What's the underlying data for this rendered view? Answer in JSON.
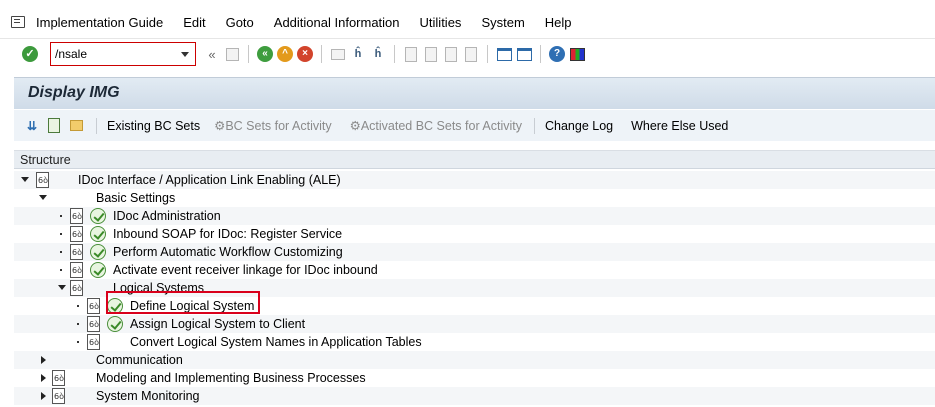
{
  "menubar": {
    "items": [
      "Implementation Guide",
      "Edit",
      "Goto",
      "Additional Information",
      "Utilities",
      "System",
      "Help"
    ]
  },
  "toolbar": {
    "command_value": "/nsale",
    "icons": [
      "enter-icon",
      "back-double-icon",
      "save-icon",
      "back-icon",
      "exit-icon",
      "cancel-icon",
      "print-icon",
      "find-icon",
      "find-next-icon",
      "first-page-icon",
      "previous-page-icon",
      "next-page-icon",
      "last-page-icon",
      "new-session-icon",
      "shortcut-icon",
      "help-icon",
      "layout-icon"
    ]
  },
  "title": "Display IMG",
  "app_toolbar": {
    "existing_bc_sets": "Existing BC Sets",
    "bc_sets_for_activity": "BC Sets for Activity",
    "activated_bc_sets": "Activated BC Sets for Activity",
    "change_log": "Change Log",
    "where_else_used": "Where Else Used"
  },
  "tree": {
    "header": "Structure",
    "rows": [
      {
        "label": "IDoc Interface / Application Link Enabling (ALE)",
        "level": 0,
        "expanded": true
      },
      {
        "label": "Basic Settings",
        "level": 1,
        "expanded": true
      },
      {
        "label": "IDoc Administration",
        "level": 2
      },
      {
        "label": "Inbound SOAP for IDoc: Register Service",
        "level": 2
      },
      {
        "label": "Perform Automatic Workflow Customizing",
        "level": 2
      },
      {
        "label": "Activate event receiver linkage for IDoc inbound",
        "level": 2
      },
      {
        "label": "Logical Systems",
        "level": 2,
        "expanded": true
      },
      {
        "label": "Define Logical System",
        "level": 3,
        "highlighted": true
      },
      {
        "label": "Assign Logical System to Client",
        "level": 3
      },
      {
        "label": "Convert Logical System Names in Application Tables",
        "level": 3
      },
      {
        "label": "Communication",
        "level": 1,
        "expanded": false
      },
      {
        "label": "Modeling and Implementing Business Processes",
        "level": 1,
        "expanded": false
      },
      {
        "label": "System Monitoring",
        "level": 1,
        "expanded": false
      }
    ]
  },
  "colors": {
    "title_band": "#d6e1ec",
    "highlight_border": "#d9001b",
    "command_border": "#cc0000"
  }
}
